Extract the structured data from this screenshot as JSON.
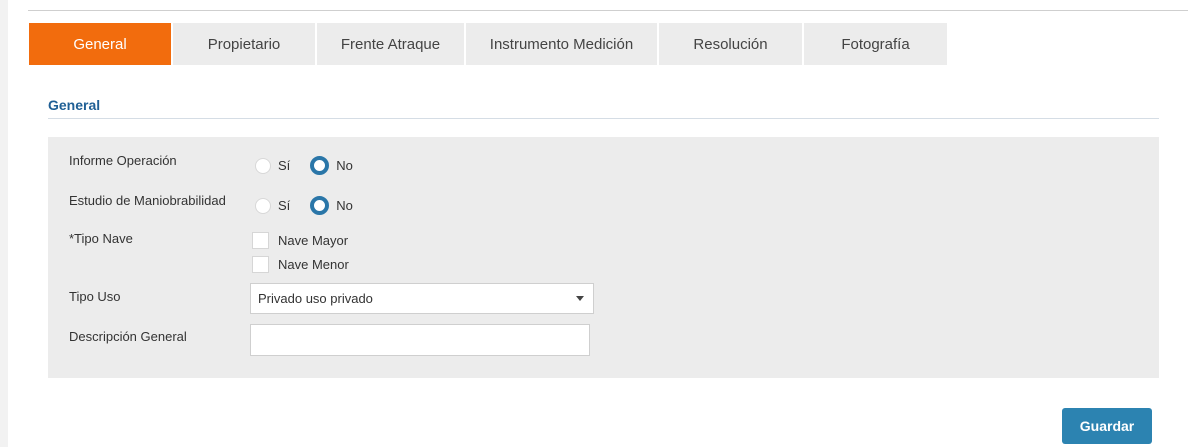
{
  "tabs": [
    {
      "label": "General",
      "active": true
    },
    {
      "label": "Propietario",
      "active": false
    },
    {
      "label": "Frente Atraque",
      "active": false
    },
    {
      "label": "Instrumento Medición",
      "active": false
    },
    {
      "label": "Resolución",
      "active": false
    },
    {
      "label": "Fotografía",
      "active": false
    }
  ],
  "section_title": "General",
  "form": {
    "informe_operacion": {
      "label": "Informe Operación",
      "options": [
        "Sí",
        "No"
      ],
      "selected": "No"
    },
    "estudio_maniobrabilidad": {
      "label": "Estudio de Maniobrabilidad",
      "options": [
        "Sí",
        "No"
      ],
      "selected": "No"
    },
    "tipo_nave": {
      "label": "*Tipo Nave",
      "options": [
        "Nave Mayor",
        "Nave Menor"
      ]
    },
    "tipo_uso": {
      "label": "Tipo Uso",
      "value": "Privado uso privado"
    },
    "descripcion_general": {
      "label": "Descripción General",
      "value": ""
    }
  },
  "save_label": "Guardar",
  "colors": {
    "active_tab": "#f26c0d",
    "accent": "#1f5f95",
    "button": "#2c83b1",
    "panel": "#ececec"
  }
}
